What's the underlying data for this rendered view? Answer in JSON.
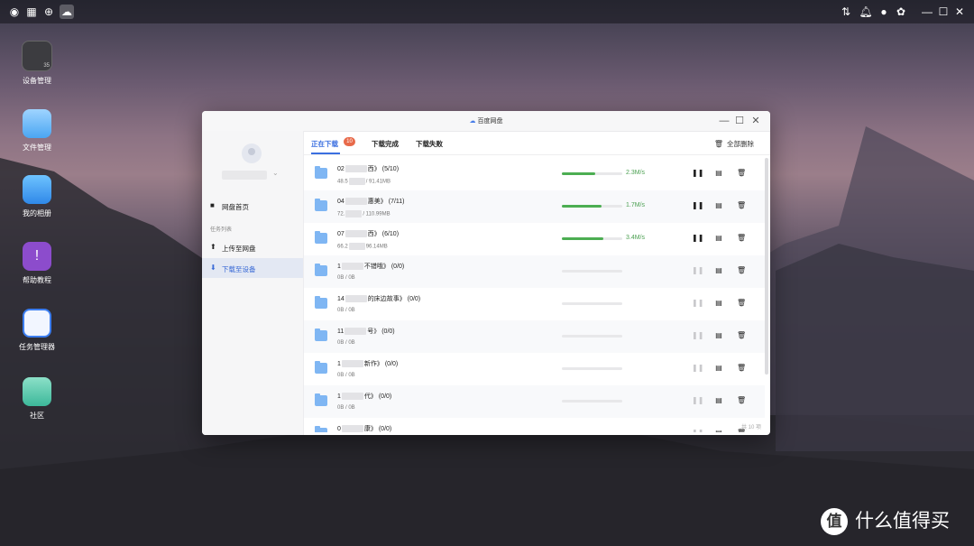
{
  "desktop": {
    "icons": [
      {
        "label": "设备管理",
        "badge": "35"
      },
      {
        "label": "文件管理"
      },
      {
        "label": "我的相册"
      },
      {
        "label": "帮助教程"
      },
      {
        "label": "任务管理器"
      },
      {
        "label": "社区"
      }
    ]
  },
  "topbar": {
    "left_icons": [
      "camera-icon",
      "apps-grid-icon",
      "globe-icon",
      "baidu-cloud-icon"
    ],
    "right_icons": [
      "adjust-icon",
      "bell-icon",
      "user-icon",
      "settings-icon"
    ],
    "window_controls": [
      "minimize-icon",
      "maximize-icon",
      "close-icon"
    ]
  },
  "window": {
    "title": "百度网盘",
    "sidebar": {
      "nav_home": "网盘首页",
      "section_label": "任务列表",
      "nav_upload": "上传至网盘",
      "nav_download": "下载至设备"
    },
    "tabs": [
      {
        "label": "正在下载",
        "badge": "10"
      },
      {
        "label": "下载完成"
      },
      {
        "label": "下载失败"
      }
    ],
    "delete_all": "全部删除",
    "rows": [
      {
        "name_prefix": "02",
        "name_suffix": "西》 (5/10)",
        "size_prefix": "48.5",
        "size_suffix": "/ 91.41MB",
        "progress": 0.55,
        "speed": "2.3M/s",
        "active": true
      },
      {
        "name_prefix": "04",
        "name_suffix": "惠美》 (7/11)",
        "size_prefix": "72.",
        "size_suffix": "/ 110.99MB",
        "progress": 0.65,
        "speed": "1.7M/s",
        "active": true
      },
      {
        "name_prefix": "07",
        "name_suffix": "西》 (6/10)",
        "size_prefix": "66.2",
        "size_suffix": "96.14MB",
        "progress": 0.68,
        "speed": "3.4M/s",
        "active": true
      },
      {
        "name_prefix": "1",
        "name_suffix": "不错哦》 (0/0)",
        "size_prefix": "0B / 0B",
        "size_suffix": "",
        "progress": 0,
        "speed": "",
        "active": false
      },
      {
        "name_prefix": "14",
        "name_suffix": "的床边故事》 (0/0)",
        "size_prefix": "0B / 0B",
        "size_suffix": "",
        "progress": 0,
        "speed": "",
        "active": false
      },
      {
        "name_prefix": "11",
        "name_suffix": "号》 (0/0)",
        "size_prefix": "0B / 0B",
        "size_suffix": "",
        "progress": 0,
        "speed": "",
        "active": false
      },
      {
        "name_prefix": "1",
        "name_suffix": "新作》 (0/0)",
        "size_prefix": "0B / 0B",
        "size_suffix": "",
        "progress": 0,
        "speed": "",
        "active": false
      },
      {
        "name_prefix": "1",
        "name_suffix": "代》 (0/0)",
        "size_prefix": "0B / 0B",
        "size_suffix": "",
        "progress": 0,
        "speed": "",
        "active": false
      },
      {
        "name_prefix": "0",
        "name_suffix": "康》 (0/0)",
        "size_prefix": "",
        "size_suffix": "",
        "progress": 0,
        "speed": "",
        "active": false
      }
    ],
    "footer": "共 10 项"
  },
  "watermark": {
    "logo": "值",
    "text": "什么值得买"
  }
}
